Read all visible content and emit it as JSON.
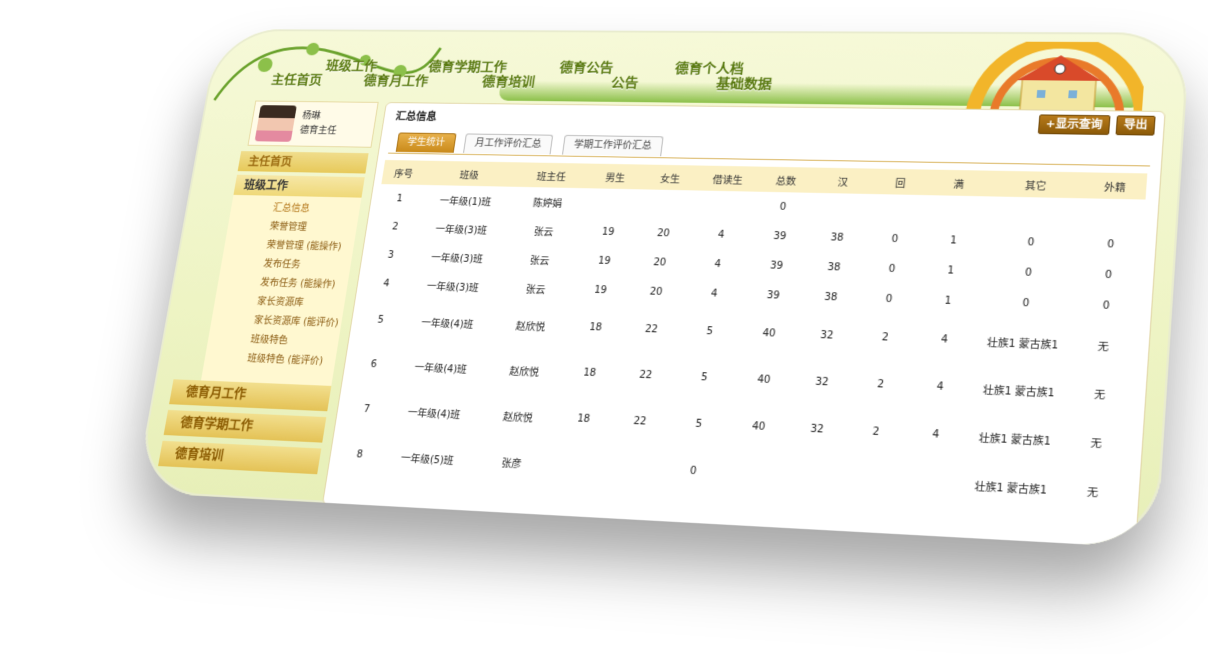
{
  "nav": {
    "row1": [
      "班级工作",
      "德育学期工作",
      "德育公告",
      "德育个人档"
    ],
    "row2": [
      "主任首页",
      "德育月工作",
      "德育培训",
      "公告",
      "基础数据"
    ]
  },
  "profile": {
    "name": "杨琳",
    "role": "德育主任"
  },
  "sidebar": {
    "home": "主任首页",
    "class_work": "班级工作",
    "sub_items": [
      "汇总信息",
      "荣誉管理",
      "荣誉管理 (能操作)",
      "发布任务",
      "发布任务 (能操作)",
      "家长资源库",
      "家长资源库 (能评价)",
      "班级特色",
      "班级特色 (能评价)"
    ],
    "monthly": "德育月工作",
    "term": "德育学期工作",
    "training": "德育培训"
  },
  "main": {
    "title": "汇总信息",
    "btn_query": "+显示查询",
    "btn_export": "导出",
    "tabs": [
      "学生统计",
      "月工作评价汇总",
      "学期工作评价汇总"
    ]
  },
  "table": {
    "headers": [
      "序号",
      "班级",
      "班主任",
      "男生",
      "女生",
      "借读生",
      "总数",
      "汉",
      "回",
      "满",
      "其它",
      "外籍"
    ],
    "rows": [
      [
        "1",
        "一年级(1)班",
        "陈婷娟",
        "",
        "",
        "",
        "0",
        "",
        "",
        "",
        "",
        ""
      ],
      [
        "2",
        "一年级(3)班",
        "张云",
        "19",
        "20",
        "4",
        "39",
        "38",
        "0",
        "1",
        "0",
        "0"
      ],
      [
        "3",
        "一年级(3)班",
        "张云",
        "19",
        "20",
        "4",
        "39",
        "38",
        "0",
        "1",
        "0",
        "0"
      ],
      [
        "4",
        "一年级(3)班",
        "张云",
        "19",
        "20",
        "4",
        "39",
        "38",
        "0",
        "1",
        "0",
        "0"
      ],
      [
        "5",
        "一年级(4)班",
        "赵欣悦",
        "18",
        "22",
        "5",
        "40",
        "32",
        "2",
        "4",
        "壮族1 蒙古族1",
        "无"
      ],
      [
        "6",
        "一年级(4)班",
        "赵欣悦",
        "18",
        "22",
        "5",
        "40",
        "32",
        "2",
        "4",
        "壮族1 蒙古族1",
        "无"
      ],
      [
        "7",
        "一年级(4)班",
        "赵欣悦",
        "18",
        "22",
        "5",
        "40",
        "32",
        "2",
        "4",
        "壮族1 蒙古族1",
        "无"
      ],
      [
        "8",
        "一年级(5)班",
        "张彦",
        "",
        "",
        "0",
        "",
        "",
        "",
        "",
        "壮族1 蒙古族1",
        "无"
      ]
    ]
  },
  "colors": {
    "accent": "#c98a1a",
    "nav_text": "#5a7a10",
    "sidebar_bg": "#f2df8e"
  }
}
